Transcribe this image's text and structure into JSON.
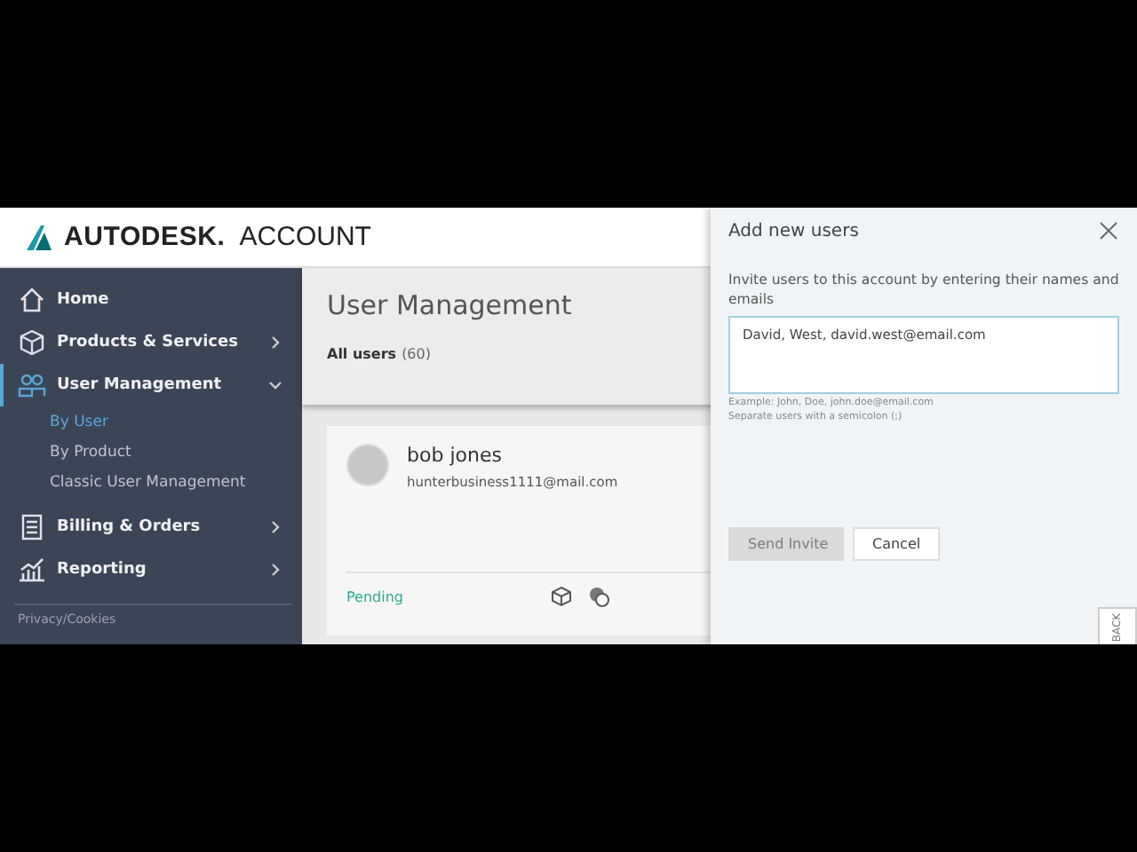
{
  "header": {
    "brand": "AUTODESK.",
    "product": "ACCOUNT"
  },
  "sidebar": {
    "items": [
      {
        "label": "Home",
        "kind": "link",
        "selected": false
      },
      {
        "label": "Products & Services",
        "kind": "group",
        "selected": false,
        "expanded": false
      },
      {
        "label": "User Management",
        "kind": "group",
        "selected": true,
        "expanded": true,
        "children": [
          {
            "label": "By User",
            "selected": true
          },
          {
            "label": "By Product",
            "selected": false
          },
          {
            "label": "Classic User Management",
            "selected": false
          }
        ]
      },
      {
        "label": "Billing & Orders",
        "kind": "group",
        "selected": false,
        "expanded": false
      },
      {
        "label": "Reporting",
        "kind": "group",
        "selected": false,
        "expanded": false
      }
    ],
    "footer": "Privacy/Cookies"
  },
  "main": {
    "title": "User Management",
    "filter_label": "All users",
    "filter_count": "(60)",
    "user_card": {
      "name": "bob jones",
      "email": "hunterbusiness1111@mail.com",
      "status": "Pending"
    }
  },
  "panel": {
    "title": "Add new users",
    "description": "Invite users to this account by entering their names and emails",
    "input_value": "David, West, david.west@email.com",
    "hints": [
      "Example: John, Doe, john.doe@email.com",
      "Separate users with a semicolon (;)"
    ],
    "buttons": [
      {
        "label": "Send Invite",
        "disabled": true
      },
      {
        "label": "Cancel",
        "disabled": false
      }
    ],
    "feedback_tab": "BACK"
  }
}
